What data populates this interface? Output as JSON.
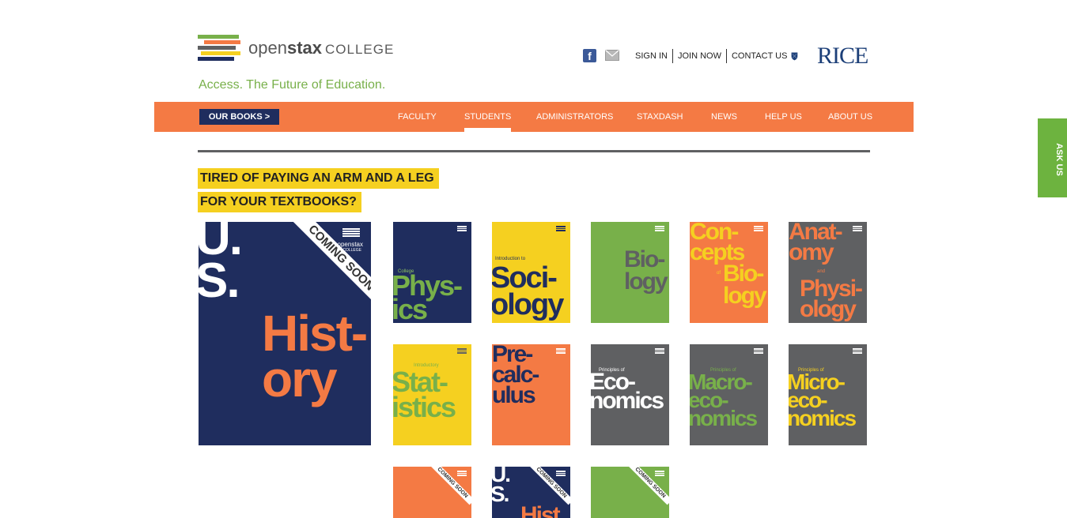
{
  "header": {
    "logo_text_light": "open",
    "logo_text_bold": "stax",
    "logo_college": "COLLEGE",
    "tagline": "Access. The Future of Education.",
    "logo_bar_colors": [
      "#78b04a",
      "#f47a44",
      "#5f6062",
      "#f5d020",
      "#1f2d5e"
    ]
  },
  "utility": {
    "facebook_letter": "f",
    "links": [
      "SIGN IN",
      "JOIN NOW",
      "CONTACT US"
    ],
    "rice_label": "RICE"
  },
  "nav": {
    "our_books": "OUR BOOKS  >",
    "items": [
      "FACULTY",
      "STUDENTS",
      "ADMINISTRATORS",
      "STAXDASH",
      "NEWS",
      "HELP US",
      "ABOUT US"
    ],
    "active": "STUDENTS",
    "bar_color": "#f47a44"
  },
  "headline": {
    "line1": "TIRED OF PAYING AN ARM AND A LEG",
    "line2": "FOR YOUR TEXTBOOKS?"
  },
  "books": {
    "history": {
      "prefix": "U.\nS.",
      "title": "Hist-\nory",
      "ribbon": "COMING SOON",
      "logo_text": "openstax",
      "logo_sub": "COLLEGE"
    },
    "physics": {
      "sub": "College",
      "title": "Phys-\nics"
    },
    "sociology": {
      "sub": "Introduction to",
      "title": "Soci-\nology"
    },
    "biology": {
      "title": "Bio-\nlogy"
    },
    "concepts": {
      "title": "Con-\ncepts",
      "of": "of",
      "title2": "Bio-\nlogy"
    },
    "anatomy": {
      "title": "Anat-\nomy",
      "and": "and",
      "title2": "Physi-\nology"
    },
    "statistics": {
      "sub": "Introductory",
      "title": "Stat-\nistics"
    },
    "precalculus": {
      "title": "Pre-\ncalc-\nulus"
    },
    "economics": {
      "sub": "Principles of",
      "title": "Eco-\nnomics"
    },
    "macro": {
      "sub": "Principles of",
      "title": "Macro-\neco-\nnomics"
    },
    "micro": {
      "sub": "Principles of",
      "title": "Micro-\neco-\nnomics"
    },
    "coming1": {
      "ribbon": "COMING SOON"
    },
    "coming2": {
      "prefix": "U.\nS.",
      "title": "Hist",
      "ribbon": "COMING SOON"
    },
    "coming3": {
      "ribbon": "COMING SOON"
    }
  },
  "ask_us": "ASK US",
  "colors": {
    "navy": "#1f2d5e",
    "orange": "#f47a44",
    "yellow": "#f5d020",
    "green": "#78b04a",
    "gray": "#5f6062"
  }
}
